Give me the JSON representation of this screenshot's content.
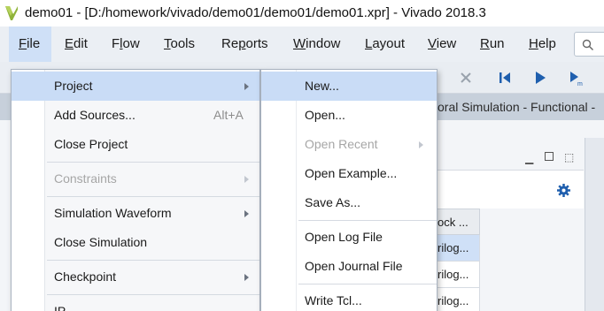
{
  "window": {
    "title": "demo01 - [D:/homework/vivado/demo01/demo01/demo01.xpr] - Vivado 2018.3"
  },
  "menubar": {
    "items": [
      {
        "label": "File",
        "mnemonic": "F",
        "rest": "ile"
      },
      {
        "label": "Edit",
        "mnemonic": "E",
        "rest": "dit"
      },
      {
        "label": "Flow",
        "mnemonic": "l",
        "pre": "F",
        "rest": "ow"
      },
      {
        "label": "Tools",
        "mnemonic": "T",
        "rest": "ools"
      },
      {
        "label": "Reports",
        "mnemonic": "p",
        "pre": "Re",
        "rest": "orts"
      },
      {
        "label": "Window",
        "mnemonic": "W",
        "rest": "indow"
      },
      {
        "label": "Layout",
        "mnemonic": "L",
        "rest": "ayout"
      },
      {
        "label": "View",
        "mnemonic": "V",
        "rest": "iew"
      },
      {
        "label": "Run",
        "mnemonic": "R",
        "rest": "un"
      },
      {
        "label": "Help",
        "mnemonic": "H",
        "rest": "elp"
      }
    ]
  },
  "file_menu": {
    "items": [
      {
        "label": "Project",
        "has_submenu": true,
        "highlighted": true
      },
      {
        "label": "Add Sources...",
        "shortcut": "Alt+A"
      },
      {
        "label": "Close Project"
      },
      {
        "label": "Constraints",
        "has_submenu": true,
        "disabled": true
      },
      {
        "label": "Simulation Waveform",
        "has_submenu": true
      },
      {
        "label": "Close Simulation"
      },
      {
        "label": "Checkpoint",
        "has_submenu": true
      },
      {
        "label": "IP"
      }
    ]
  },
  "project_submenu": {
    "items": [
      {
        "label": "New...",
        "highlighted": true
      },
      {
        "label": "Open..."
      },
      {
        "label": "Open Recent",
        "has_submenu": true,
        "disabled": true
      },
      {
        "label": "Open Example..."
      },
      {
        "label": "Save As..."
      },
      {
        "label": "Open Log File"
      },
      {
        "label": "Open Journal File"
      },
      {
        "label": "Write Tcl..."
      }
    ]
  },
  "background": {
    "sim_title": "oral Simulation - Functional -",
    "column_header": "ock ...",
    "rows": [
      "rilog...",
      "rilog...",
      "rilog..."
    ]
  },
  "colors": {
    "highlight": "#c9dcf6",
    "accent_blue": "#1f5fae"
  }
}
